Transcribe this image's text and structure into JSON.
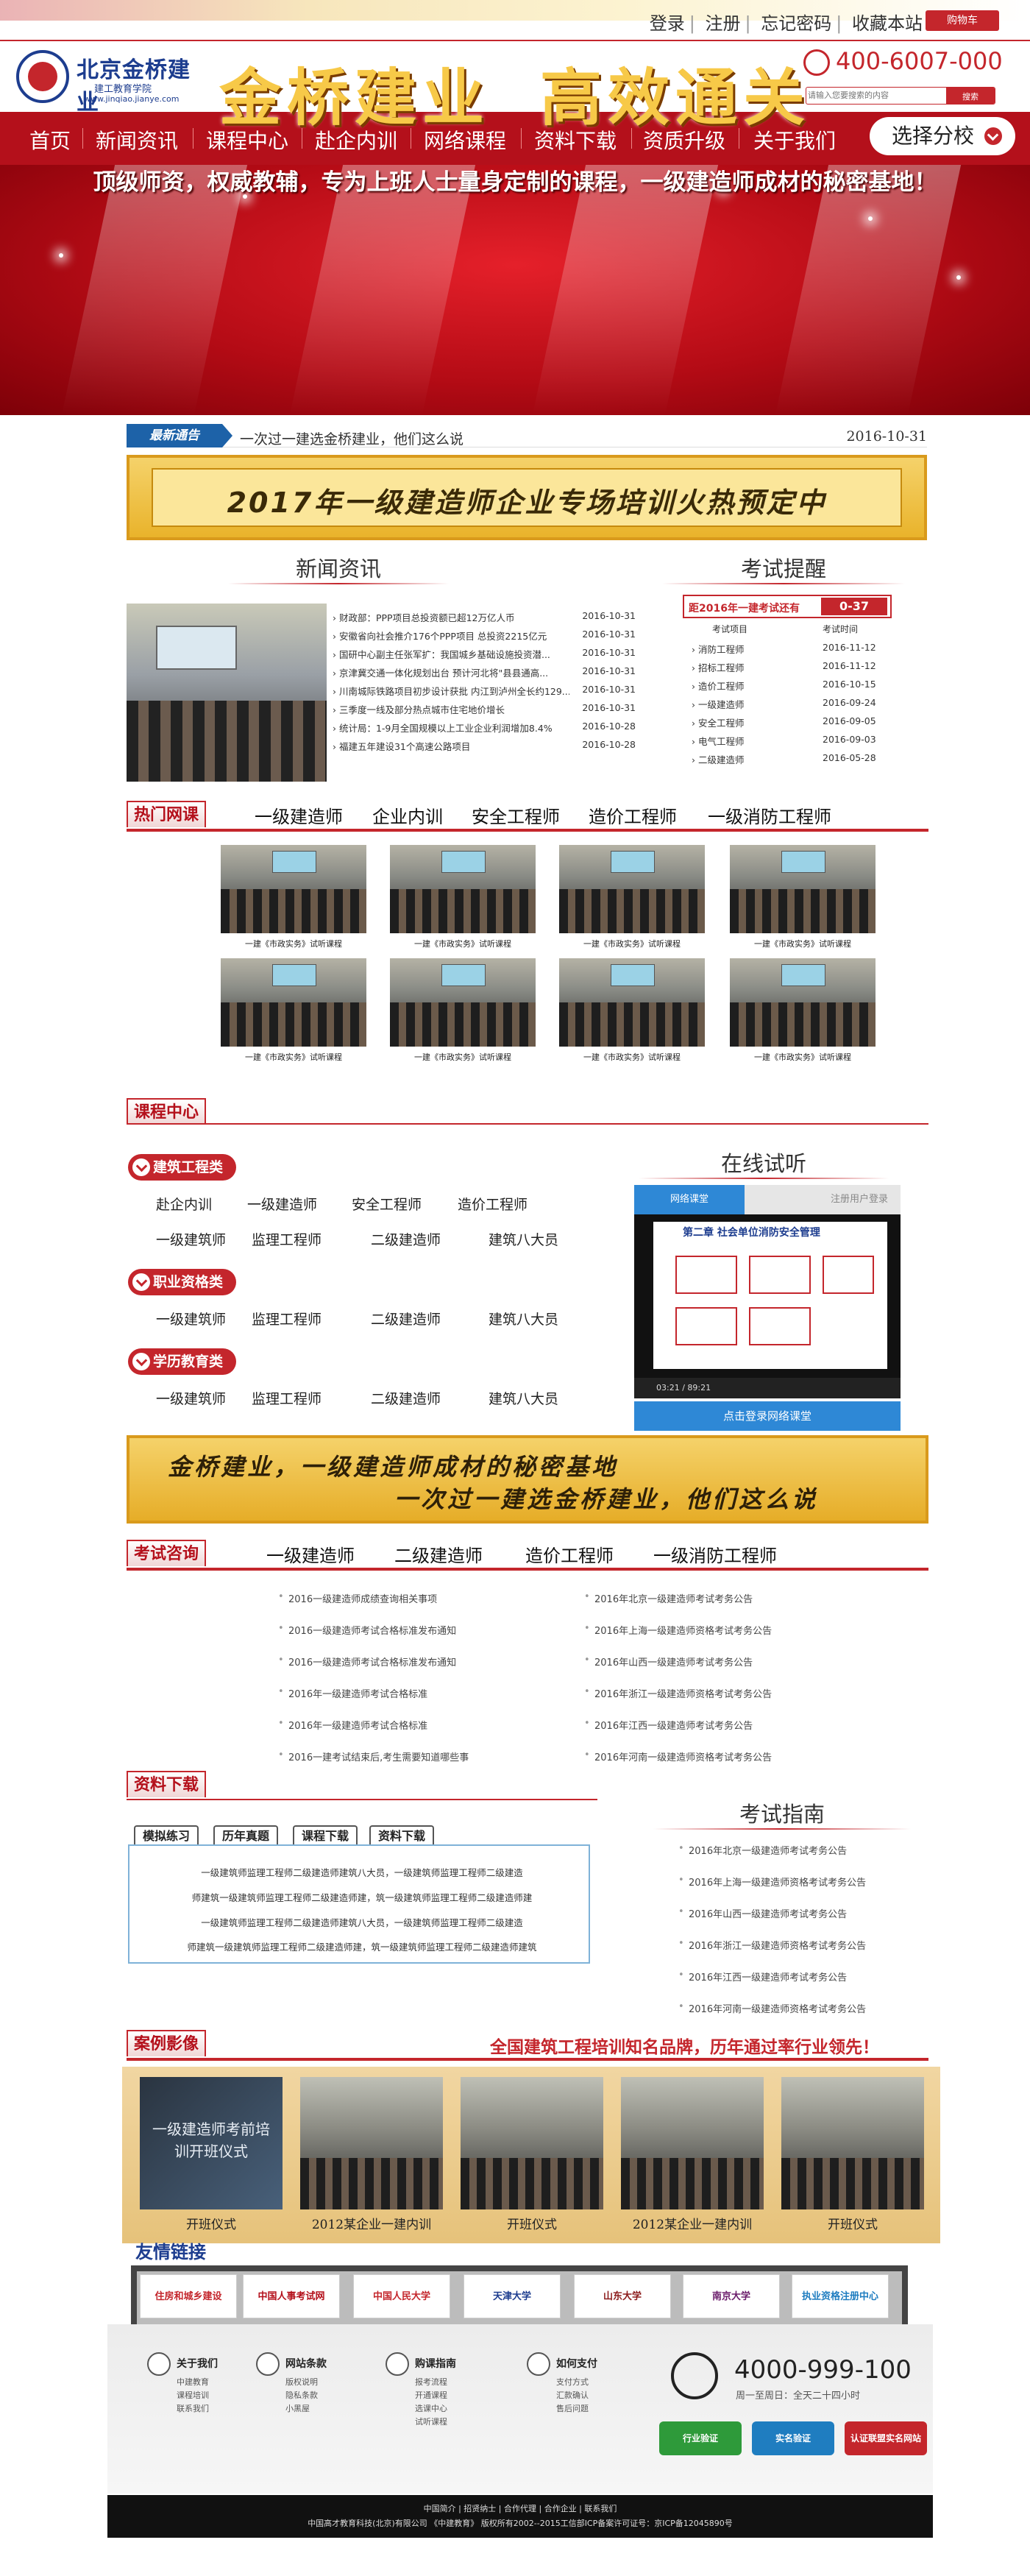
{
  "top": {
    "links": [
      "登录",
      "注册",
      "忘记密码",
      "收藏本站"
    ],
    "cart": "购物车",
    "phone": "400-6007-000",
    "search_placeholder": "请输入您要搜索的内容",
    "search_button": "搜索"
  },
  "logo": {
    "name": "北京金桥建业",
    "sub": "建工教育学院",
    "url": "www.jinqiao.jianye.com"
  },
  "nav": {
    "items": [
      "首页",
      "新闻资讯",
      "课程中心",
      "赴企内训",
      "网络课程",
      "资料下载",
      "资质升级",
      "关于我们"
    ],
    "branch": "选择分校"
  },
  "banner": {
    "title_a": "金桥建业",
    "title_b": "高效通关",
    "subtitle": "顶级师资，权威教辅，专为上班人士量身定制的课程，一级建造师成材的秘密基地！"
  },
  "notice": {
    "tag": "最新通告",
    "text": "一次过一建选金桥建业，他们这么说",
    "date": "2016-10-31"
  },
  "promo1": "2017年一级建造师企业专场培训火热预定中",
  "news": {
    "title": "新闻资讯",
    "items": [
      {
        "t": "财政部：PPP项目总投资额已超12万亿人币",
        "d": "2016-10-31"
      },
      {
        "t": "安徽省向社会推介176个PPP项目 总投资2215亿元",
        "d": "2016-10-31"
      },
      {
        "t": "国研中心副主任张军扩：我国城乡基础设施投资潜...",
        "d": "2016-10-31"
      },
      {
        "t": "京津冀交通一体化规划出台 预计河北将\"县县通高...",
        "d": "2016-10-31"
      },
      {
        "t": "川南城际铁路项目初步设计获批 内江到泸州全长约129...",
        "d": "2016-10-31"
      },
      {
        "t": "三季度一线及部分热点城市住宅地价增长",
        "d": "2016-10-31"
      },
      {
        "t": "统计局：1-9月全国规模以上工业企业利润增加8.4%",
        "d": "2016-10-28"
      },
      {
        "t": "福建五年建设31个高速公路项目",
        "d": "2016-10-28"
      }
    ]
  },
  "remind": {
    "title": "考试提醒",
    "countdown_label": "距2016年一建考试还有",
    "countdown": "0-37",
    "col_a": "考试项目",
    "col_b": "考试时间",
    "rows": [
      {
        "n": "消防工程师",
        "d": "2016-11-12"
      },
      {
        "n": "招标工程师",
        "d": "2016-11-12"
      },
      {
        "n": "造价工程师",
        "d": "2016-10-15"
      },
      {
        "n": "一级建造师",
        "d": "2016-09-24"
      },
      {
        "n": "安全工程师",
        "d": "2016-09-05"
      },
      {
        "n": "电气工程师",
        "d": "2016-09-03"
      },
      {
        "n": "二级建造师",
        "d": "2016-05-28"
      }
    ]
  },
  "hot": {
    "label": "热门网课",
    "tabs": [
      "一级建造师",
      "企业内训",
      "安全工程师",
      "造价工程师",
      "一级消防工程师"
    ],
    "caption": "一建《市政实务》试听课程"
  },
  "course": {
    "label": "课程中心",
    "cats": [
      {
        "name": "建筑工程类",
        "rows": [
          [
            "赴企内训",
            "一级建造师",
            "安全工程师",
            "造价工程师"
          ],
          [
            "一级建筑师",
            "监理工程师",
            "二级建造师",
            "建筑八大员"
          ]
        ]
      },
      {
        "name": "职业资格类",
        "rows": [
          [
            "一级建筑师",
            "监理工程师",
            "二级建造师",
            "建筑八大员"
          ]
        ]
      },
      {
        "name": "学历教育类",
        "rows": [
          [
            "一级建筑师",
            "监理工程师",
            "二级建造师",
            "建筑八大员"
          ]
        ]
      }
    ]
  },
  "online": {
    "title": "在线试听",
    "tab_a": "网络课堂",
    "tab_b": "注册用户登录",
    "slide_title": "第二章 社会单位消防安全管理",
    "time": "03:21 / 89:21",
    "go": "点击登录网络课堂"
  },
  "promo2": {
    "line1": "金桥建业，一级建造师成材的秘密基地",
    "line2": "一次过一建选金桥建业，他们这么说"
  },
  "consult": {
    "label": "考试咨询",
    "tabs": [
      "一级建造师",
      "二级建造师",
      "造价工程师",
      "一级消防工程师"
    ],
    "left": [
      "2016一级建造师成绩查询相关事项",
      "2016一级建造师考试合格标准发布通知",
      "2016一级建造师考试合格标准发布通知",
      "2016年一级建造师考试合格标准",
      "2016年一级建造师考试合格标准",
      "2016一建考试结束后,考生需要知道哪些事"
    ],
    "right": [
      "2016年北京一级建造师考试考务公告",
      "2016年上海一级建造师资格考试考务公告",
      "2016年山西一级建造师考试考务公告",
      "2016年浙江一级建造师资格考试考务公告",
      "2016年江西一级建造师考试考务公告",
      "2016年河南一级建造师资格考试考务公告"
    ]
  },
  "download": {
    "label": "资料下载",
    "tabs": [
      "模拟练习",
      "历年真题",
      "课程下载",
      "资料下载"
    ],
    "lines": [
      "一级建筑师监理工程师二级建造师建筑八大员，一级建筑师监理工程师二级建造",
      "师建筑一级建筑师监理工程师二级建造师建，筑一级建筑师监理工程师二级建造师建",
      "一级建筑师监理工程师二级建造师建筑八大员，一级建筑师监理工程师二级建造",
      "师建筑一级建筑师监理工程师二级建造师建，筑一级建筑师监理工程师二级建造师建筑"
    ]
  },
  "guide": {
    "title": "考试指南",
    "items": [
      "2016年北京一级建造师考试考务公告",
      "2016年上海一级建造师资格考试考务公告",
      "2016年山西一级建造师考试考务公告",
      "2016年浙江一级建造师资格考试考务公告",
      "2016年江西一级建造师考试考务公告",
      "2016年河南一级建造师资格考试考务公告"
    ]
  },
  "cases": {
    "label": "案例影像",
    "slogan": "全国建筑工程培训知名品牌，历年通过率行业领先！",
    "captions": [
      "开班仪式",
      "2012某企业一建内训",
      "开班仪式",
      "2012某企业一建内训",
      "开班仪式"
    ],
    "screen_text": "一级建造师考前培训开班仪式"
  },
  "links": {
    "label": "友情链接",
    "items": [
      "住房和城乡建设",
      "中国人事考试网",
      "中国人民大学",
      "天津大学",
      "山东大学",
      "南京大学",
      "执业资格注册中心"
    ]
  },
  "footer": {
    "cols": [
      {
        "h": "关于我们",
        "items": [
          "中建教育",
          "课程培训",
          "联系我们"
        ]
      },
      {
        "h": "网站条款",
        "items": [
          "版权说明",
          "隐私条款",
          "小黑屋"
        ]
      },
      {
        "h": "购课指南",
        "items": [
          "报考流程",
          "开通课程",
          "选课中心",
          "试听课程"
        ]
      },
      {
        "h": "如何支付",
        "items": [
          "支付方式",
          "汇款确认",
          "售后问题"
        ]
      }
    ],
    "phone": "4000-999-100",
    "hours": "周一至周日：全天二十四小时",
    "badges": [
      "行业验证",
      "实名验证",
      "认证联盟实名网站"
    ],
    "bottom_links": "中国简介 | 招贤纳士 | 合作代理 | 合作企业 | 联系我们",
    "copyright": "中国高才教育科技(北京)有限公司 《中建教育》 版权所有2002--2015工信部ICP备案许可证号：京ICP备12045890号"
  }
}
